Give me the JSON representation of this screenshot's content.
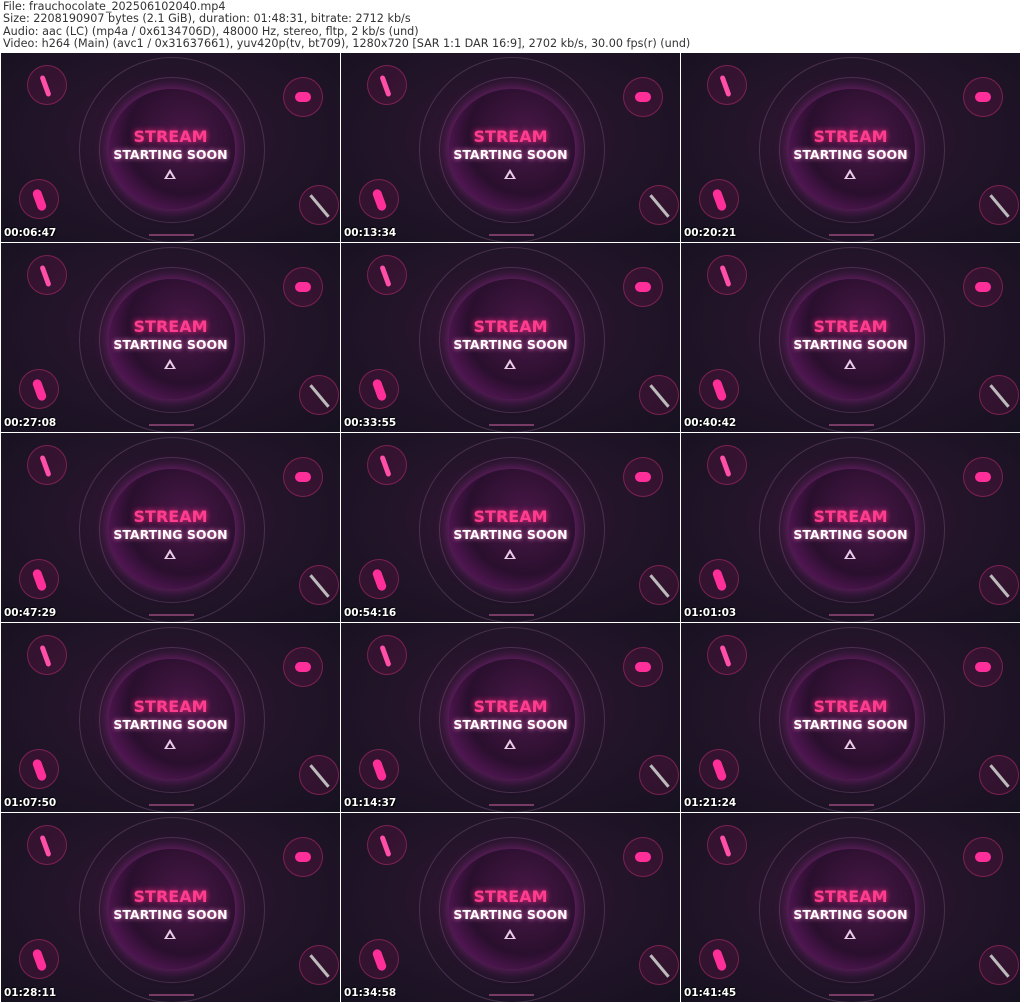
{
  "header": {
    "file": "File: frauchocolate_202506102040.mp4",
    "size": "Size: 2208190907 bytes (2.1 GiB), duration: 01:48:31, bitrate: 2712 kb/s",
    "audio": "Audio: aac (LC) (mp4a / 0x6134706D), 48000 Hz, stereo, fltp, 2 kb/s (und)",
    "video": "Video: h264 (Main) (avc1 / 0x31637661), yuv420p(tv, bt709), 1280x720 [SAR 1:1 DAR 16:9], 2702 kb/s, 30.00 fps(r) (und)"
  },
  "frame_text": {
    "line1": "STREAM",
    "line2": "STARTING SOON"
  },
  "thumbnails": [
    "00:06:47",
    "00:13:34",
    "00:20:21",
    "00:27:08",
    "00:33:55",
    "00:40:42",
    "00:47:29",
    "00:54:16",
    "01:01:03",
    "01:07:50",
    "01:14:37",
    "01:21:24",
    "01:28:11",
    "01:34:58",
    "01:41:45"
  ]
}
